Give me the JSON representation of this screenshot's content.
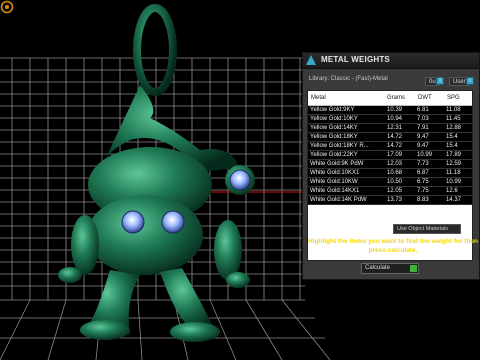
{
  "panel": {
    "title": "METAL WEIGHTS",
    "library": "Library: Classic - (Fast)-Metal",
    "btn_left": "0u",
    "btn_user": "User",
    "columns": [
      "Metal",
      "Grams",
      "DWT",
      "SPG"
    ],
    "rows": [
      [
        "Yellow Gold:9KY",
        "10.39",
        "6.81",
        "11.08"
      ],
      [
        "Yellow Gold:10KY",
        "10.94",
        "7.03",
        "11.45"
      ],
      [
        "Yellow Gold:14KY",
        "12.31",
        "7.91",
        "12.88"
      ],
      [
        "Yellow Gold:18KY",
        "14.72",
        "9.47",
        "15.4"
      ],
      [
        "Yellow Gold:18KY R...",
        "14.72",
        "9.47",
        "15.4"
      ],
      [
        "Yellow Gold:22KY",
        "17.09",
        "10.99",
        "17.89"
      ],
      [
        "White Gold:9K PdW",
        "12.03",
        "7.73",
        "12.59"
      ],
      [
        "White Gold:10KX1",
        "10.68",
        "6.87",
        "11.18"
      ],
      [
        "White Gold:10KW",
        "10.50",
        "6.75",
        "10.99"
      ],
      [
        "White Gold:14KX1",
        "12.05",
        "7.75",
        "12.6"
      ],
      [
        "White Gold:14K PdW",
        "13.73",
        "8.83",
        "14.37"
      ]
    ],
    "use_object_materials": "Use Object Materials",
    "hint": "Highlight the items you want to find the weight for then press calculate.",
    "calculate": "Calculate"
  },
  "colors": {
    "model_green": "#1f7a55",
    "grid": "#8a8a8a",
    "hint_yellow": "#f5d800",
    "accent_blue": "#3aa6c8"
  }
}
